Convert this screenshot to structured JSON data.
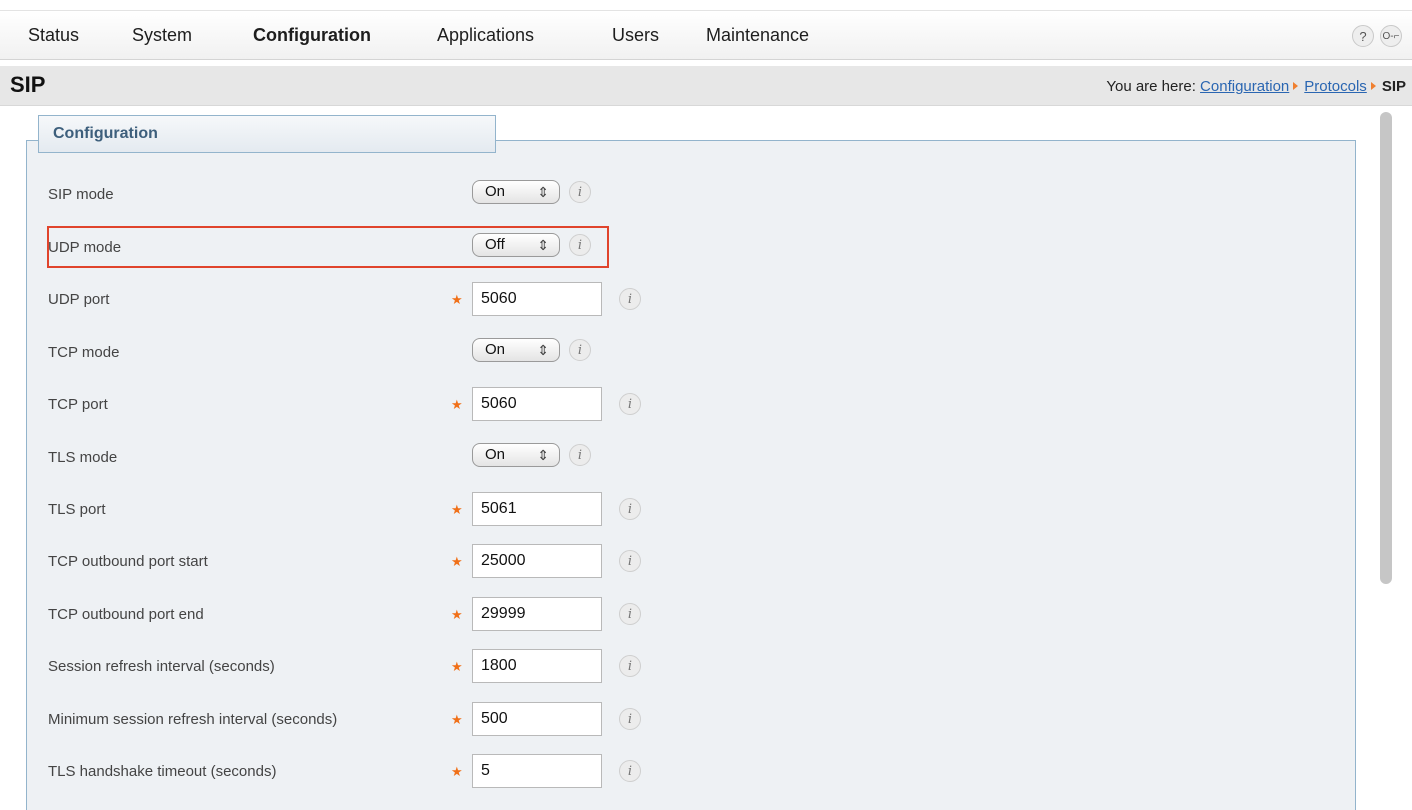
{
  "nav": {
    "items": [
      {
        "label": "Status"
      },
      {
        "label": "System"
      },
      {
        "label": "Configuration"
      },
      {
        "label": "Applications"
      },
      {
        "label": "Users"
      },
      {
        "label": "Maintenance"
      }
    ],
    "active": "Configuration",
    "help_icon_glyph": "?",
    "logout_icon_glyph": "O-⌐"
  },
  "header": {
    "title": "SIP",
    "breadcrumb_prefix": "You are here:",
    "breadcrumb": [
      "Configuration",
      "Protocols",
      "SIP"
    ]
  },
  "panel": {
    "title": "Configuration",
    "info_glyph": "i",
    "required_glyph": "★",
    "select_arrows_glyph": "⇕",
    "rows": [
      {
        "label": "SIP mode",
        "type": "select",
        "value": "On"
      },
      {
        "label": "UDP mode",
        "type": "select",
        "value": "Off",
        "highlighted": true
      },
      {
        "label": "UDP port",
        "type": "text",
        "value": "5060",
        "required": true
      },
      {
        "label": "TCP mode",
        "type": "select",
        "value": "On"
      },
      {
        "label": "TCP port",
        "type": "text",
        "value": "5060",
        "required": true
      },
      {
        "label": "TLS mode",
        "type": "select",
        "value": "On"
      },
      {
        "label": "TLS port",
        "type": "text",
        "value": "5061",
        "required": true
      },
      {
        "label": "TCP outbound port start",
        "type": "text",
        "value": "25000",
        "required": true
      },
      {
        "label": "TCP outbound port end",
        "type": "text",
        "value": "29999",
        "required": true
      },
      {
        "label": "Session refresh interval (seconds)",
        "type": "text",
        "value": "1800",
        "required": true
      },
      {
        "label": "Minimum session refresh interval (seconds)",
        "type": "text",
        "value": "500",
        "required": true
      },
      {
        "label": "TLS handshake timeout (seconds)",
        "type": "text",
        "value": "5",
        "required": true
      }
    ]
  },
  "colors": {
    "accent_link": "#2a66b2",
    "required_star": "#f07018",
    "highlight_border": "#e0442c",
    "panel_border": "#93b4cc"
  }
}
